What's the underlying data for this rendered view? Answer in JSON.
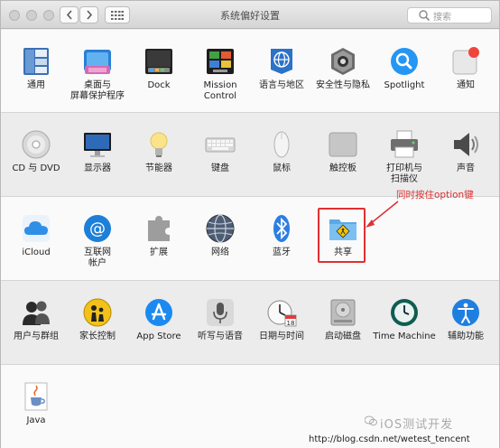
{
  "window": {
    "title": "系统偏好设置"
  },
  "search": {
    "placeholder": "搜索"
  },
  "sections": [
    {
      "items": [
        {
          "label": "通用",
          "icon": "general-icon"
        },
        {
          "label": "桌面与\n屏幕保护程序",
          "icon": "desktop-screensaver-icon"
        },
        {
          "label": "Dock",
          "icon": "dock-icon"
        },
        {
          "label": "Mission\nControl",
          "icon": "mission-control-icon"
        },
        {
          "label": "语言与地区",
          "icon": "language-region-icon"
        },
        {
          "label": "安全性与隐私",
          "icon": "security-privacy-icon"
        },
        {
          "label": "Spotlight",
          "icon": "spotlight-icon"
        },
        {
          "label": "通知",
          "icon": "notifications-icon"
        }
      ]
    },
    {
      "items": [
        {
          "label": "CD 与 DVD",
          "icon": "cd-dvd-icon"
        },
        {
          "label": "显示器",
          "icon": "displays-icon"
        },
        {
          "label": "节能器",
          "icon": "energy-saver-icon"
        },
        {
          "label": "键盘",
          "icon": "keyboard-icon"
        },
        {
          "label": "鼠标",
          "icon": "mouse-icon"
        },
        {
          "label": "触控板",
          "icon": "trackpad-icon"
        },
        {
          "label": "打印机与\n扫描仪",
          "icon": "printer-scanner-icon"
        },
        {
          "label": "声音",
          "icon": "sound-icon"
        }
      ]
    },
    {
      "items": [
        {
          "label": "iCloud",
          "icon": "icloud-icon"
        },
        {
          "label": "互联网\n帐户",
          "icon": "internet-accounts-icon"
        },
        {
          "label": "扩展",
          "icon": "extensions-icon"
        },
        {
          "label": "网络",
          "icon": "network-icon"
        },
        {
          "label": "蓝牙",
          "icon": "bluetooth-icon"
        },
        {
          "label": "共享",
          "icon": "sharing-icon"
        }
      ]
    },
    {
      "items": [
        {
          "label": "用户与群组",
          "icon": "users-groups-icon"
        },
        {
          "label": "家长控制",
          "icon": "parental-controls-icon"
        },
        {
          "label": "App Store",
          "icon": "app-store-icon"
        },
        {
          "label": "听写与语音",
          "icon": "dictation-speech-icon"
        },
        {
          "label": "日期与时间",
          "icon": "date-time-icon"
        },
        {
          "label": "启动磁盘",
          "icon": "startup-disk-icon"
        },
        {
          "label": "Time Machine",
          "icon": "time-machine-icon"
        },
        {
          "label": "辅助功能",
          "icon": "accessibility-icon"
        }
      ]
    },
    {
      "items": [
        {
          "label": "Java",
          "icon": "java-icon"
        }
      ]
    }
  ],
  "annotation": {
    "text": "同时按住option键"
  },
  "watermark": {
    "text": "iOS测试开发",
    "url": "http://blog.csdn.net/wetest_tencent"
  },
  "colors": {
    "annotation": "#e03030",
    "accent": "#1e7fd8"
  }
}
